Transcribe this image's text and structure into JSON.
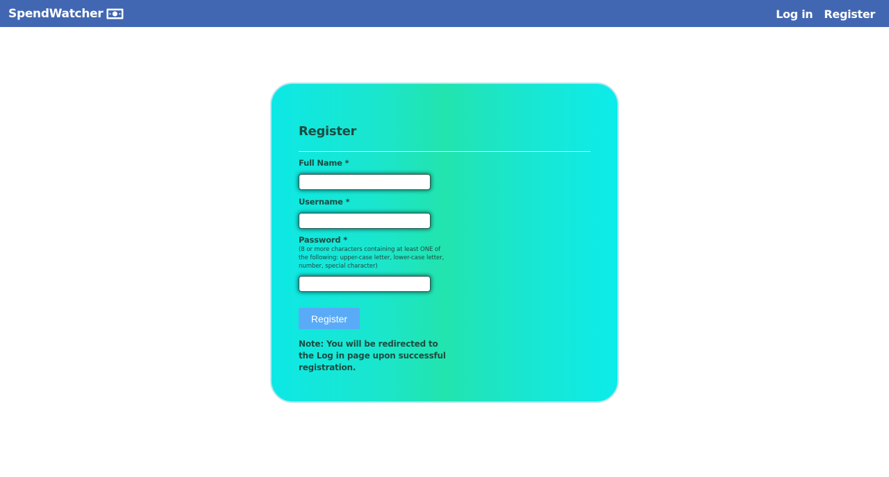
{
  "nav": {
    "brand": "SpendWatcher",
    "brand_icon": "money-bill-icon",
    "links": [
      {
        "label": "Log in"
      },
      {
        "label": "Register"
      }
    ]
  },
  "form": {
    "title": "Register",
    "fields": {
      "full_name": {
        "label": "Full Name *",
        "value": ""
      },
      "username": {
        "label": "Username *",
        "value": ""
      },
      "password": {
        "label": "Password *",
        "hint": "(8 or more characters containing at least ONE of the following: upper-case letter, lower-case letter, number, special character)",
        "value": ""
      }
    },
    "submit_label": "Register",
    "note": "Note: You will be redirected to the Log in page upon successful registration."
  },
  "colors": {
    "navbar": "#4267b2",
    "button": "#5aabf7",
    "text": "#1e4b40",
    "card_gradient_edge": "#0de8e6",
    "card_gradient_center": "#22e4ae"
  }
}
